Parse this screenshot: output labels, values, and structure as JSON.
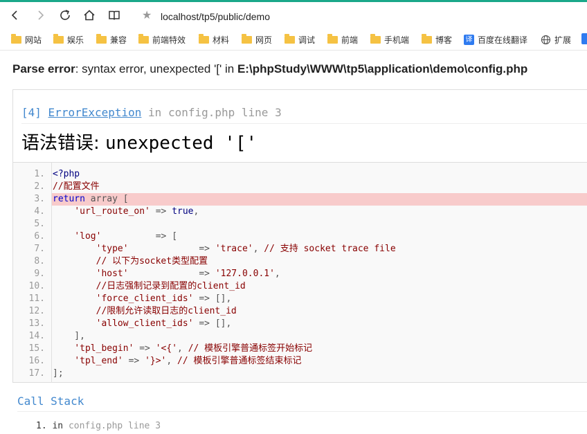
{
  "browser": {
    "url": "localhost/tp5/public/demo",
    "accent_color": "#1aa88a",
    "nav": {
      "back_icon": "arrow-left-icon",
      "forward_icon": "arrow-right-icon",
      "reload_icon": "reload-icon",
      "home_icon": "home-icon",
      "reader_icon": "reading-mode-icon",
      "bookmark_icon": "star-icon"
    },
    "bookmarks": [
      {
        "label": "网站",
        "icon": "folder-icon"
      },
      {
        "label": "娱乐",
        "icon": "folder-icon"
      },
      {
        "label": "兼容",
        "icon": "folder-icon"
      },
      {
        "label": "前端特效",
        "icon": "folder-icon"
      },
      {
        "label": "材料",
        "icon": "folder-icon"
      },
      {
        "label": "网页",
        "icon": "folder-icon"
      },
      {
        "label": "调试",
        "icon": "folder-icon"
      },
      {
        "label": "前端",
        "icon": "folder-icon"
      },
      {
        "label": "手机端",
        "icon": "folder-icon"
      },
      {
        "label": "博客",
        "icon": "folder-icon"
      },
      {
        "label": "百度在线翻译",
        "icon": "translate-icon",
        "icon_text": "译"
      },
      {
        "label": "扩展",
        "icon": "globe-icon"
      }
    ]
  },
  "parse_error": {
    "label": "Parse error",
    "message": ": syntax error, unexpected '[' in ",
    "path": "E:\\phpStudy\\WWW\\tp5\\application\\demo\\config.php"
  },
  "exception": {
    "number": "[4]",
    "class": "ErrorException",
    "in_word": " in ",
    "file": "config.php",
    "line_text": " line 3",
    "message_zh": "语法错误: ",
    "message_code": "unexpected '['",
    "highlight_line": 3,
    "highlight_color": "#f8cbcb",
    "code_lines": [
      {
        "n": "1.",
        "parts": [
          {
            "t": "<?php",
            "c": "t"
          }
        ]
      },
      {
        "n": "2.",
        "parts": [
          {
            "t": "//配置文件",
            "c": "c"
          }
        ]
      },
      {
        "n": "3.",
        "parts": [
          {
            "t": "return",
            "c": "k"
          },
          {
            "t": " array [",
            "c": "p"
          }
        ]
      },
      {
        "n": "4.",
        "parts": [
          {
            "t": "    ",
            "c": "p"
          },
          {
            "t": "'url_route_on'",
            "c": "s"
          },
          {
            "t": " => ",
            "c": "p"
          },
          {
            "t": "true",
            "c": "t"
          },
          {
            "t": ",",
            "c": "p"
          }
        ]
      },
      {
        "n": "5.",
        "parts": []
      },
      {
        "n": "6.",
        "parts": [
          {
            "t": "    ",
            "c": "p"
          },
          {
            "t": "'log'",
            "c": "s"
          },
          {
            "t": "          => [",
            "c": "p"
          }
        ]
      },
      {
        "n": "7.",
        "parts": [
          {
            "t": "        ",
            "c": "p"
          },
          {
            "t": "'type'",
            "c": "s"
          },
          {
            "t": "             => ",
            "c": "p"
          },
          {
            "t": "'trace'",
            "c": "s"
          },
          {
            "t": ", ",
            "c": "p"
          },
          {
            "t": "// 支持 socket trace file",
            "c": "c"
          }
        ]
      },
      {
        "n": "8.",
        "parts": [
          {
            "t": "        ",
            "c": "p"
          },
          {
            "t": "// 以下为socket类型配置",
            "c": "c"
          }
        ]
      },
      {
        "n": "9.",
        "parts": [
          {
            "t": "        ",
            "c": "p"
          },
          {
            "t": "'host'",
            "c": "s"
          },
          {
            "t": "             => ",
            "c": "p"
          },
          {
            "t": "'127.0.0.1'",
            "c": "s"
          },
          {
            "t": ",",
            "c": "p"
          }
        ]
      },
      {
        "n": "10.",
        "parts": [
          {
            "t": "        ",
            "c": "p"
          },
          {
            "t": "//日志强制记录到配置的client_id",
            "c": "c"
          }
        ]
      },
      {
        "n": "11.",
        "parts": [
          {
            "t": "        ",
            "c": "p"
          },
          {
            "t": "'force_client_ids'",
            "c": "s"
          },
          {
            "t": " => [],",
            "c": "p"
          }
        ]
      },
      {
        "n": "12.",
        "parts": [
          {
            "t": "        ",
            "c": "p"
          },
          {
            "t": "//限制允许读取日志的client_id",
            "c": "c"
          }
        ]
      },
      {
        "n": "13.",
        "parts": [
          {
            "t": "        ",
            "c": "p"
          },
          {
            "t": "'allow_client_ids'",
            "c": "s"
          },
          {
            "t": " => [],",
            "c": "p"
          }
        ]
      },
      {
        "n": "14.",
        "parts": [
          {
            "t": "    ],",
            "c": "p"
          }
        ]
      },
      {
        "n": "15.",
        "parts": [
          {
            "t": "    ",
            "c": "p"
          },
          {
            "t": "'tpl_begin'",
            "c": "s"
          },
          {
            "t": " => ",
            "c": "p"
          },
          {
            "t": "'<{'",
            "c": "s"
          },
          {
            "t": ", ",
            "c": "p"
          },
          {
            "t": "// 模板引擎普通标签开始标记",
            "c": "c"
          }
        ]
      },
      {
        "n": "16.",
        "parts": [
          {
            "t": "    ",
            "c": "p"
          },
          {
            "t": "'tpl_end'",
            "c": "s"
          },
          {
            "t": " => ",
            "c": "p"
          },
          {
            "t": "'}>'",
            "c": "s"
          },
          {
            "t": ", ",
            "c": "p"
          },
          {
            "t": "// 模板引擎普通标签结束标记",
            "c": "c"
          }
        ]
      },
      {
        "n": "17.",
        "parts": [
          {
            "t": "];",
            "c": "p"
          }
        ]
      }
    ]
  },
  "call_stack": {
    "title": "Call Stack",
    "items": [
      {
        "num": "1.",
        "in_word": "in ",
        "file": "config.php line 3"
      }
    ]
  }
}
